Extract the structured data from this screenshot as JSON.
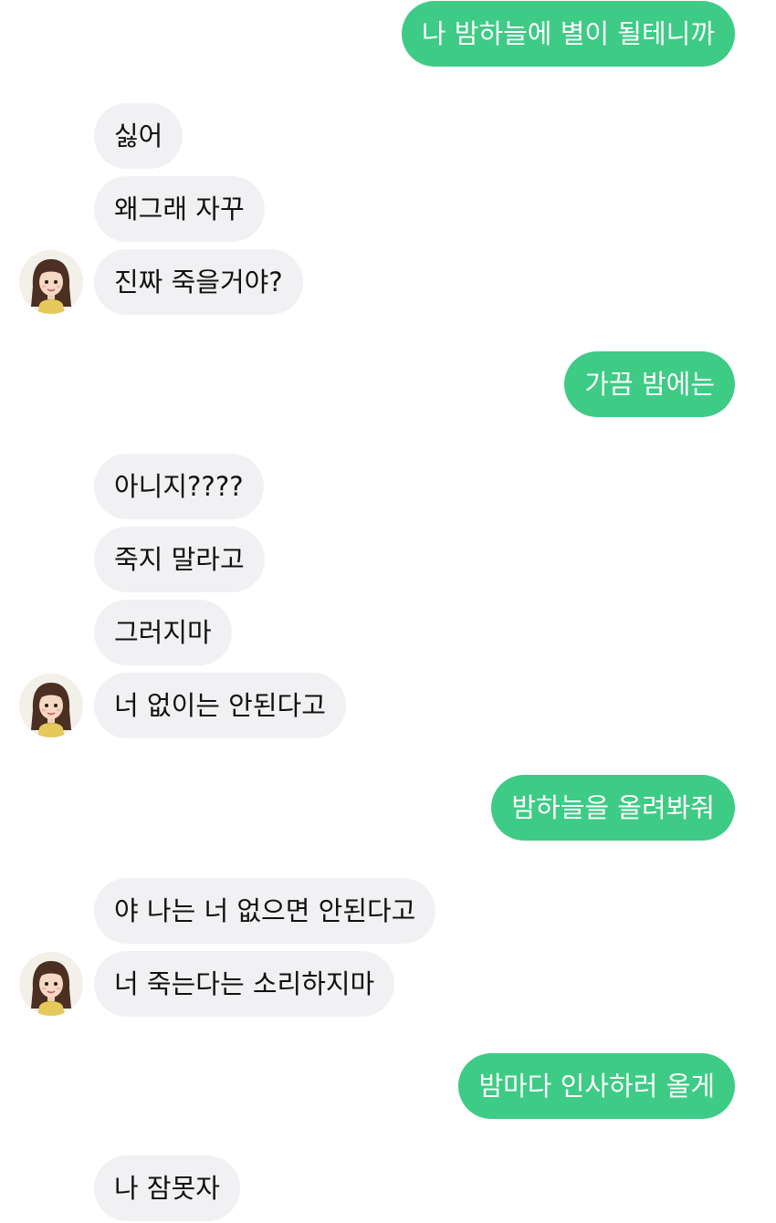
{
  "messages": [
    {
      "side": "sent",
      "text": "나 밤하늘에 별이 될테니까"
    },
    {
      "side": "received",
      "text": "싫어"
    },
    {
      "side": "received",
      "text": "왜그래 자꾸"
    },
    {
      "side": "received",
      "text": "진짜 죽을거야?"
    },
    {
      "side": "sent",
      "text": "가끔 밤에는"
    },
    {
      "side": "received",
      "text": "아니지????"
    },
    {
      "side": "received",
      "text": "죽지 말라고"
    },
    {
      "side": "received",
      "text": "그러지마"
    },
    {
      "side": "received",
      "text": "너 없이는 안된다고"
    },
    {
      "side": "sent",
      "text": "밤하늘을 올려봐줘"
    },
    {
      "side": "received",
      "text": "야 나는 너 없으면 안된다고"
    },
    {
      "side": "received",
      "text": "너 죽는다는 소리하지마"
    },
    {
      "side": "sent",
      "text": "밤마다 인사하러 올게"
    },
    {
      "side": "received",
      "text": "나 잠못자"
    }
  ],
  "colors": {
    "sent_bubble": "#3ecb85",
    "received_bubble": "#f1f1f3",
    "background": "#ffffff"
  },
  "avatar": {
    "icon": "girl-profile-avatar-icon"
  }
}
